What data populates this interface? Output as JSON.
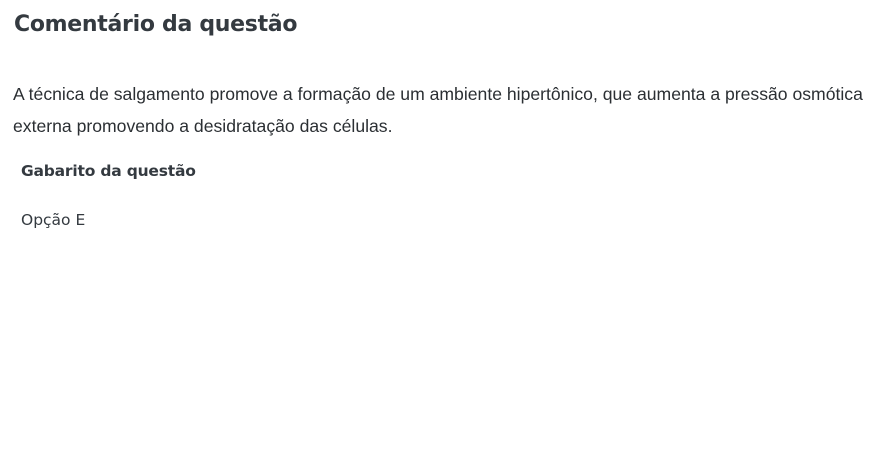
{
  "comment": {
    "title": "Comentário da questão",
    "text": "A técnica de salgamento promove a formação de um ambiente hipertônico, que aumenta a pressão osmótica externa promovendo a desidratação das células."
  },
  "answer": {
    "heading": "Gabarito da questão",
    "value": "Opção E"
  }
}
